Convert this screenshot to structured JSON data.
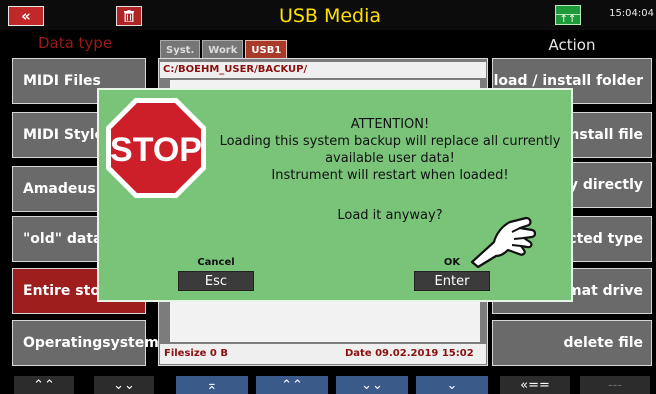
{
  "header": {
    "back_symbol": "«",
    "title": "USB Media",
    "usb_indicator": "↑↑",
    "clock": "15:04:04"
  },
  "left_panel": {
    "title": "Data type",
    "items": [
      {
        "label": "MIDI Files"
      },
      {
        "label": "MIDI Styles"
      },
      {
        "label": "Amadeus S"
      },
      {
        "label": "\"old\" data"
      },
      {
        "label": "Entire store"
      },
      {
        "label": "Operatingsystem"
      }
    ]
  },
  "file_browser": {
    "tabs": [
      "Syst.",
      "Work",
      "USB1"
    ],
    "active_tab": "USB1",
    "path": "C:/BOEHM_USER/BACKUP/",
    "filesize": "Filesize  0 B",
    "date": "Date  09.02.2019  15:02"
  },
  "right_panel": {
    "title": "Action",
    "items": [
      {
        "label": "load  /  install folder"
      },
      {
        "label": "install file"
      },
      {
        "label": "ay  directly"
      },
      {
        "label": "ected  type"
      },
      {
        "label": "rmat  drive"
      },
      {
        "label": "delete  file"
      }
    ]
  },
  "bottom_bar": {
    "buttons": [
      "⌃⌃",
      "⌄⌄",
      "⌅",
      "⌃⌃",
      "⌄⌄",
      "⌄",
      "«==",
      "---"
    ]
  },
  "dialog": {
    "stop_label": "STOP",
    "lines": [
      "ATTENTION!",
      "Loading this system backup will replace all currently",
      "available user data!",
      "Instrument will restart when loaded!"
    ],
    "question": "Load it anyway?",
    "cancel": {
      "caption": "Cancel",
      "key": "Esc"
    },
    "ok": {
      "caption": "OK",
      "key": "Enter"
    }
  },
  "colors": {
    "dialog_bg": "#7ac47a",
    "title_yellow": "#ffe000",
    "stop_red": "#cc1f2a",
    "button_gray": "#6a6a6a",
    "active_red": "#9e1d1d"
  }
}
